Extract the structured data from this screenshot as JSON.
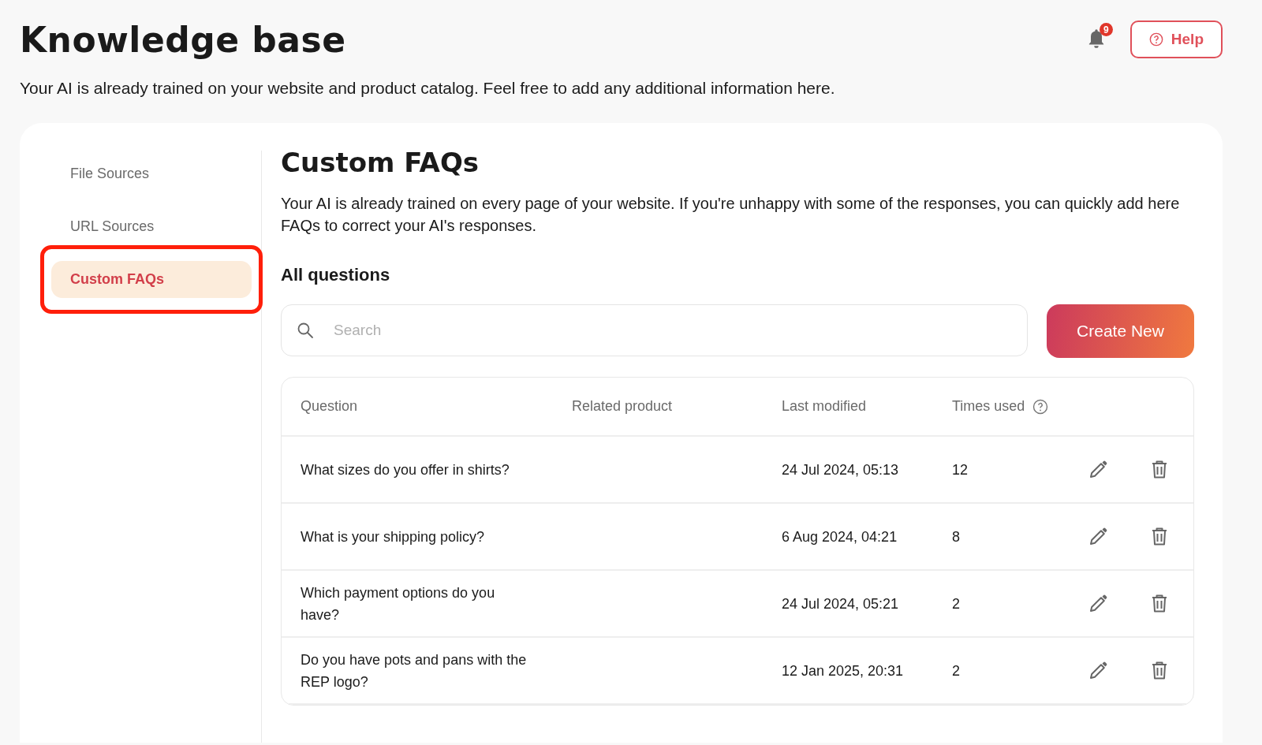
{
  "header": {
    "title": "Knowledge base",
    "subtitle": "Your AI is already trained on your website and product catalog. Feel free to add any additional information here.",
    "notifications": {
      "count": "9"
    },
    "help_button": {
      "label": "Help"
    }
  },
  "sidebar": {
    "items": [
      {
        "label": "File Sources",
        "selected": false,
        "highlighted": false
      },
      {
        "label": "URL Sources",
        "selected": false,
        "highlighted": false
      },
      {
        "label": "Custom FAQs",
        "selected": true,
        "highlighted": true
      }
    ]
  },
  "content": {
    "title": "Custom FAQs",
    "description": "Your AI is already trained on every page of your website. If you're unhappy with some of the responses, you can quickly add here FAQs to correct your AI's responses.",
    "section_title": "All questions",
    "search": {
      "placeholder": "Search"
    },
    "create_button": {
      "label": "Create New"
    },
    "table": {
      "columns": [
        {
          "label": "Question",
          "info": false
        },
        {
          "label": "Related product",
          "info": false
        },
        {
          "label": "Last modified",
          "info": false
        },
        {
          "label": "Times used",
          "info": true
        }
      ],
      "rows": [
        {
          "question": "What sizes do you offer in shirts?",
          "last_modified": "24 Jul 2024, 05:13",
          "times_used": "12"
        },
        {
          "question": "What is your shipping policy?",
          "last_modified": "6 Aug 2024, 04:21",
          "times_used": "8"
        },
        {
          "question": "Which payment options do you have?",
          "last_modified": "24 Jul 2024, 05:21",
          "times_used": "2"
        },
        {
          "question": "Do you have pots and pans with the REP logo?",
          "last_modified": "12 Jan 2025, 20:31",
          "times_used": "2"
        }
      ]
    }
  }
}
